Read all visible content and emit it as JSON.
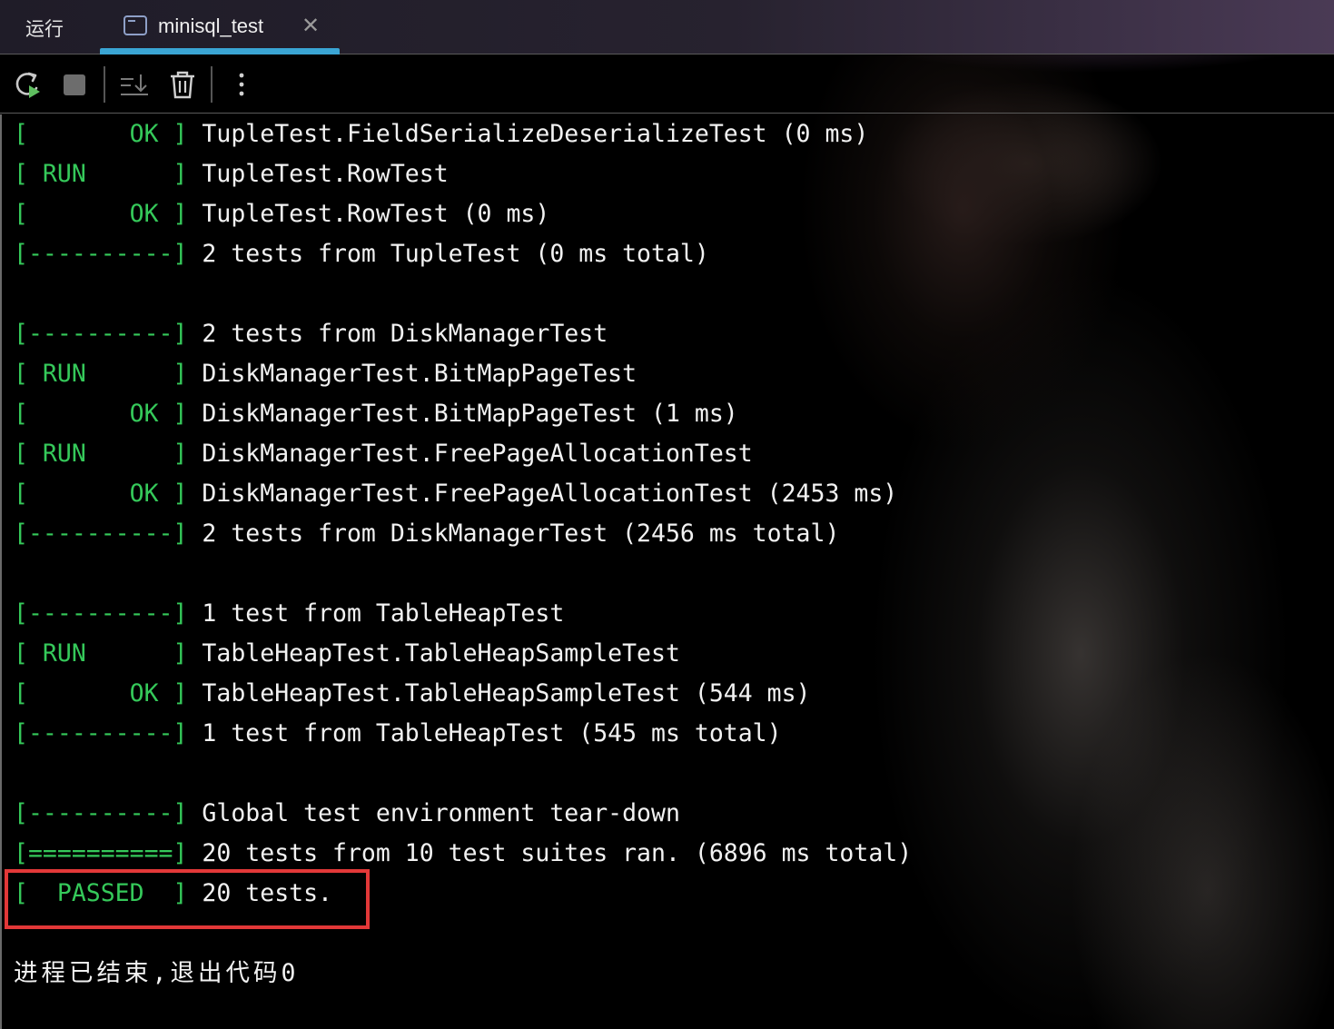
{
  "tabbar": {
    "run_label": "运行",
    "tab_title": "minisql_test",
    "tab_icon": "console-icon",
    "close_glyph": "✕"
  },
  "toolbar": {
    "buttons": [
      "rerun-icon",
      "stop-icon",
      "scroll-to-end-icon",
      "clear-trash-icon",
      "more-vertical-icon"
    ]
  },
  "console": {
    "lines": [
      {
        "tag": "[       OK ]",
        "msg": "TupleTest.FieldSerializeDeserializeTest (0 ms)"
      },
      {
        "tag": "[ RUN      ]",
        "msg": "TupleTest.RowTest"
      },
      {
        "tag": "[       OK ]",
        "msg": "TupleTest.RowTest (0 ms)"
      },
      {
        "tag": "[----------]",
        "msg": "2 tests from TupleTest (0 ms total)"
      },
      {
        "tag": "",
        "msg": ""
      },
      {
        "tag": "[----------]",
        "msg": "2 tests from DiskManagerTest"
      },
      {
        "tag": "[ RUN      ]",
        "msg": "DiskManagerTest.BitMapPageTest"
      },
      {
        "tag": "[       OK ]",
        "msg": "DiskManagerTest.BitMapPageTest (1 ms)"
      },
      {
        "tag": "[ RUN      ]",
        "msg": "DiskManagerTest.FreePageAllocationTest"
      },
      {
        "tag": "[       OK ]",
        "msg": "DiskManagerTest.FreePageAllocationTest (2453 ms)"
      },
      {
        "tag": "[----------]",
        "msg": "2 tests from DiskManagerTest (2456 ms total)"
      },
      {
        "tag": "",
        "msg": ""
      },
      {
        "tag": "[----------]",
        "msg": "1 test from TableHeapTest"
      },
      {
        "tag": "[ RUN      ]",
        "msg": "TableHeapTest.TableHeapSampleTest"
      },
      {
        "tag": "[       OK ]",
        "msg": "TableHeapTest.TableHeapSampleTest (544 ms)"
      },
      {
        "tag": "[----------]",
        "msg": "1 test from TableHeapTest (545 ms total)"
      },
      {
        "tag": "",
        "msg": ""
      },
      {
        "tag": "[----------]",
        "msg": "Global test environment tear-down"
      },
      {
        "tag": "[==========]",
        "msg": "20 tests from 10 test suites ran. (6896 ms total)"
      },
      {
        "tag": "[  PASSED  ]",
        "msg": "20 tests."
      }
    ],
    "exit_message": "进程已结束,退出代码0"
  },
  "colors": {
    "tag_green": "#35c95a",
    "tab_accent": "#3aa5d4",
    "highlight_red": "#e23838"
  }
}
